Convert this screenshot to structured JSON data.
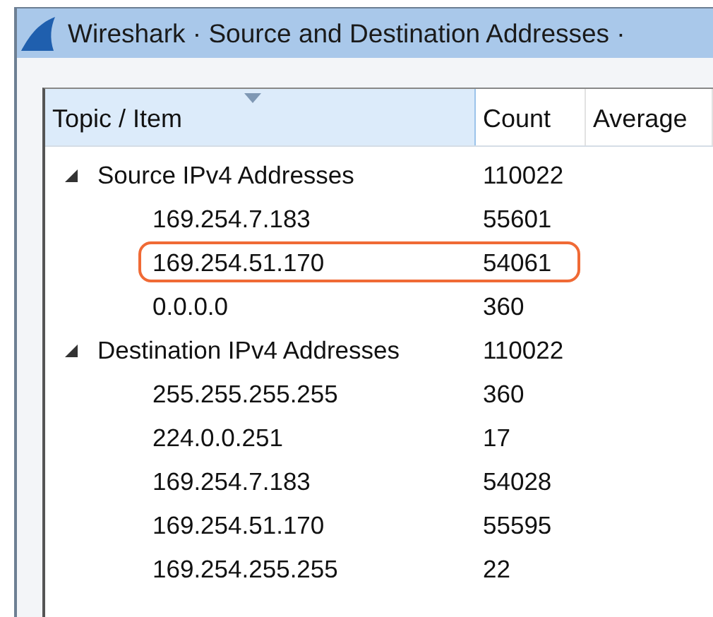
{
  "window": {
    "title": "Wireshark · Source and Destination Addresses ·"
  },
  "table": {
    "columns": [
      {
        "label": "Topic / Item",
        "sorted": true
      },
      {
        "label": "Count",
        "sorted": false
      },
      {
        "label": "Average",
        "sorted": false
      }
    ],
    "rows": [
      {
        "label": "Source IPv4 Addresses",
        "count": "110022",
        "expanded": true,
        "children": [
          {
            "label": "169.254.7.183",
            "count": "55601",
            "highlighted": false
          },
          {
            "label": "169.254.51.170",
            "count": "54061",
            "highlighted": true
          },
          {
            "label": "0.0.0.0",
            "count": "360",
            "highlighted": false
          }
        ]
      },
      {
        "label": "Destination IPv4 Addresses",
        "count": "110022",
        "expanded": true,
        "children": [
          {
            "label": "255.255.255.255",
            "count": "360",
            "highlighted": false
          },
          {
            "label": "224.0.0.251",
            "count": "17",
            "highlighted": false
          },
          {
            "label": "169.254.7.183",
            "count": "54028",
            "highlighted": false
          },
          {
            "label": "169.254.51.170",
            "count": "55595",
            "highlighted": false
          },
          {
            "label": "169.254.255.255",
            "count": "22",
            "highlighted": false
          }
        ]
      }
    ]
  }
}
